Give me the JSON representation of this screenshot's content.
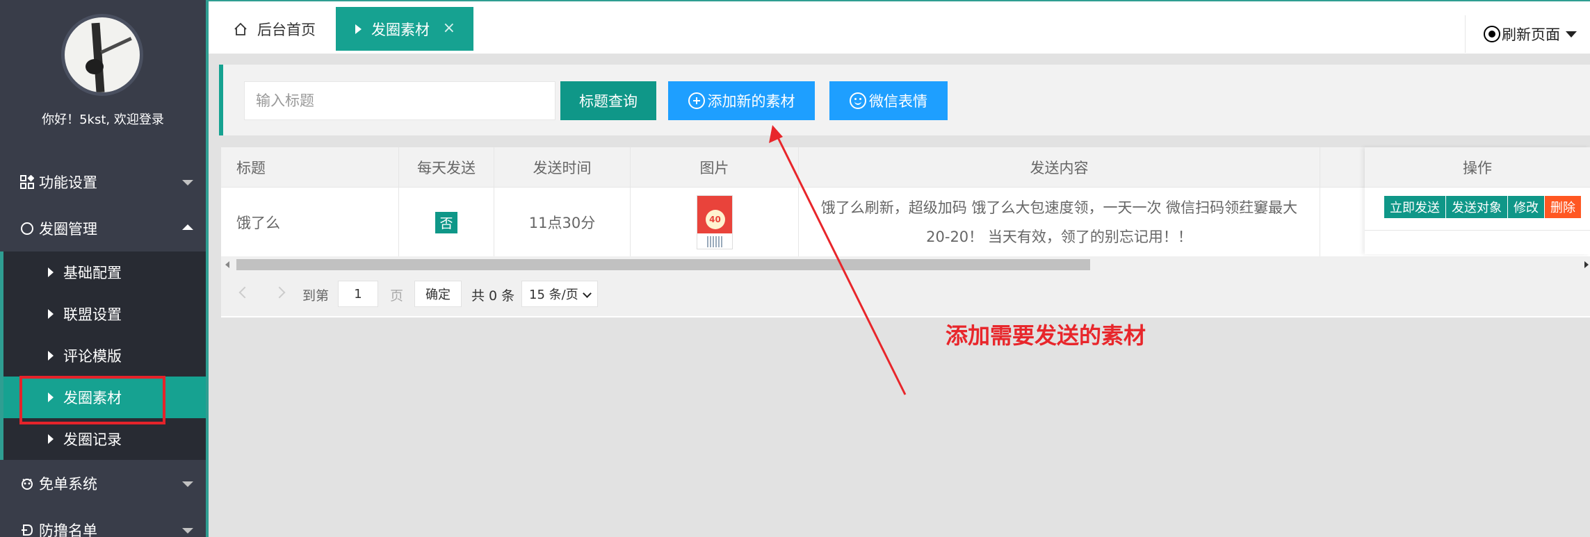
{
  "sidebar": {
    "welcome": "你好！5kst, 欢迎登录",
    "groups": [
      {
        "label": "功能设置",
        "icon": "grid-icon",
        "expanded": false
      },
      {
        "label": "发圈管理",
        "icon": "circle-icon",
        "expanded": true
      },
      {
        "label": "免单系统",
        "icon": "gift-icon",
        "expanded": false
      },
      {
        "label": "防撸名单",
        "icon": "shield-icon",
        "expanded": false
      }
    ],
    "sub_items": [
      {
        "label": "基础配置"
      },
      {
        "label": "联盟设置"
      },
      {
        "label": "评论模版"
      },
      {
        "label": "发圈素材",
        "active": true
      },
      {
        "label": "发圈记录"
      }
    ]
  },
  "tabs": {
    "home": "后台首页",
    "active": "发圈素材",
    "close": "×",
    "refresh": "刷新页面"
  },
  "toolbar": {
    "search_placeholder": "输入标题",
    "query_label": "标题查询",
    "add_label": "添加新的素材",
    "emoji_label": "微信表情"
  },
  "table": {
    "headers": [
      "标题",
      "每天发送",
      "发送时间",
      "图片",
      "发送内容",
      "操作"
    ],
    "rows": [
      {
        "title": "饿了么",
        "daily": "否",
        "time": "11点30分",
        "image": "poster-thumbnail",
        "image_text": "40",
        "content": "饿了么刷新，超级加码 饿了么大包速度领，一天一次 微信扫码领荭窶最大20-20！ 当天有效，领了的别忘记用！！"
      }
    ],
    "actions": [
      "立即发送",
      "发送对象",
      "修改",
      "删除"
    ]
  },
  "pager": {
    "goto": "到第",
    "page_value": "1",
    "page_unit": "页",
    "confirm": "确定",
    "total": "共 0 条",
    "page_size": "15 条/页"
  },
  "annotation": {
    "text": "添加需要发送的素材",
    "color": "#e8262b"
  },
  "colors": {
    "accent": "#16a291",
    "primary_blue": "#1e9fff",
    "danger": "#ff5722",
    "sidebar_bg": "#393d49"
  }
}
